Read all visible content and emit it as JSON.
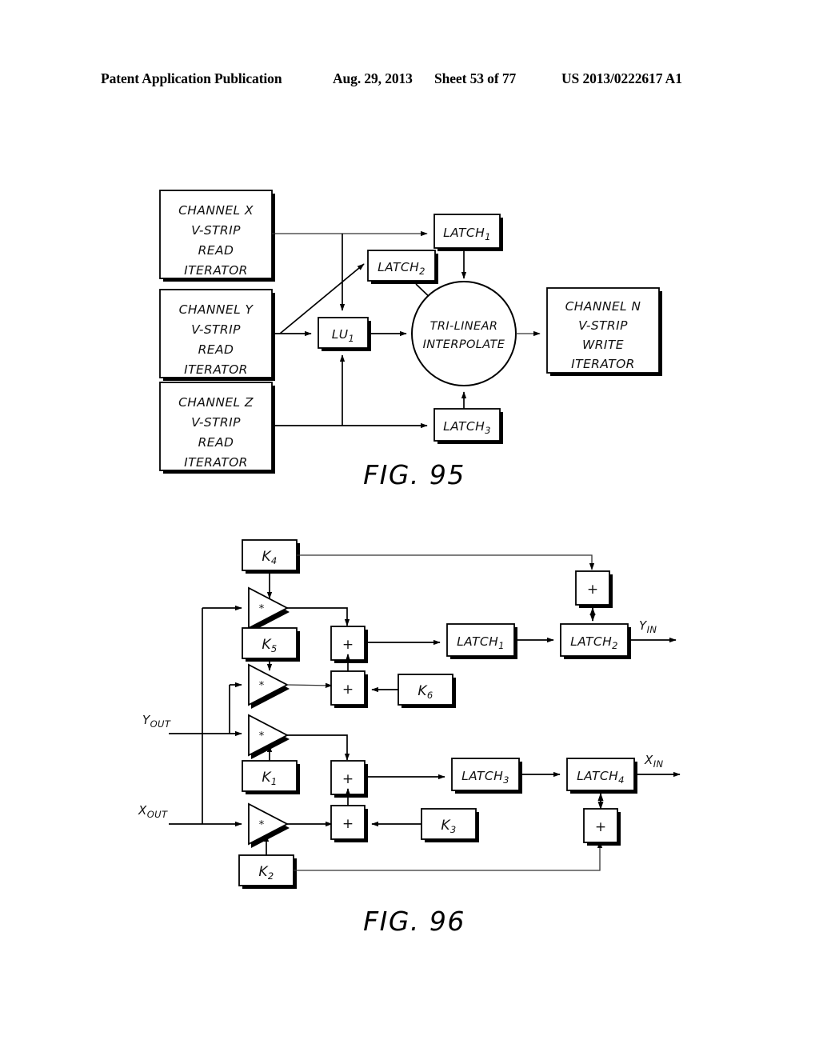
{
  "header": {
    "publication": "Patent Application Publication",
    "date": "Aug. 29, 2013",
    "sheet": "Sheet 53 of 77",
    "patent_number": "US 2013/0222617 A1"
  },
  "figures": [
    {
      "caption": "FIG. 95",
      "nodes": {
        "channel_x": "CHANNEL X\nV-STRIP\nREAD\nITERATOR",
        "channel_x_l1": "CHANNEL X",
        "channel_x_l2": "V-STRIP",
        "channel_x_l3": "READ",
        "channel_x_l4": "ITERATOR",
        "channel_y_l1": "CHANNEL Y",
        "channel_y_l2": "V-STRIP",
        "channel_y_l3": "READ",
        "channel_y_l4": "ITERATOR",
        "channel_z_l1": "CHANNEL Z",
        "channel_z_l2": "V-STRIP",
        "channel_z_l3": "READ",
        "channel_z_l4": "ITERATOR",
        "channel_n_l1": "CHANNEL N",
        "channel_n_l2": "V-STRIP",
        "channel_n_l3": "WRITE",
        "channel_n_l4": "ITERATOR",
        "latch1": "LATCH",
        "latch1_sub": "1",
        "latch2": "LATCH",
        "latch2_sub": "2",
        "latch3": "LATCH",
        "latch3_sub": "3",
        "lu1": "LU",
        "lu1_sub": "1",
        "interp_l1": "TRI-LINEAR",
        "interp_l2": "INTERPOLATE"
      }
    },
    {
      "caption": "FIG. 96",
      "nodes": {
        "k1": "K",
        "k1_sub": "1",
        "k2": "K",
        "k2_sub": "2",
        "k3": "K",
        "k3_sub": "3",
        "k4": "K",
        "k4_sub": "4",
        "k5": "K",
        "k5_sub": "5",
        "k6": "K",
        "k6_sub": "6",
        "latch1": "LATCH",
        "latch1_sub": "1",
        "latch2": "LATCH",
        "latch2_sub": "2",
        "latch3": "LATCH",
        "latch3_sub": "3",
        "latch4": "LATCH",
        "latch4_sub": "4",
        "mult_symbol": "*",
        "add_symbol": "+",
        "y_out": "Y",
        "y_out_sub": "OUT",
        "x_out": "X",
        "x_out_sub": "OUT",
        "y_in": "Y",
        "y_in_sub": "IN",
        "x_in": "X",
        "x_in_sub": "IN"
      }
    }
  ],
  "colors": {
    "ink": "#000000",
    "paper": "#ffffff"
  }
}
